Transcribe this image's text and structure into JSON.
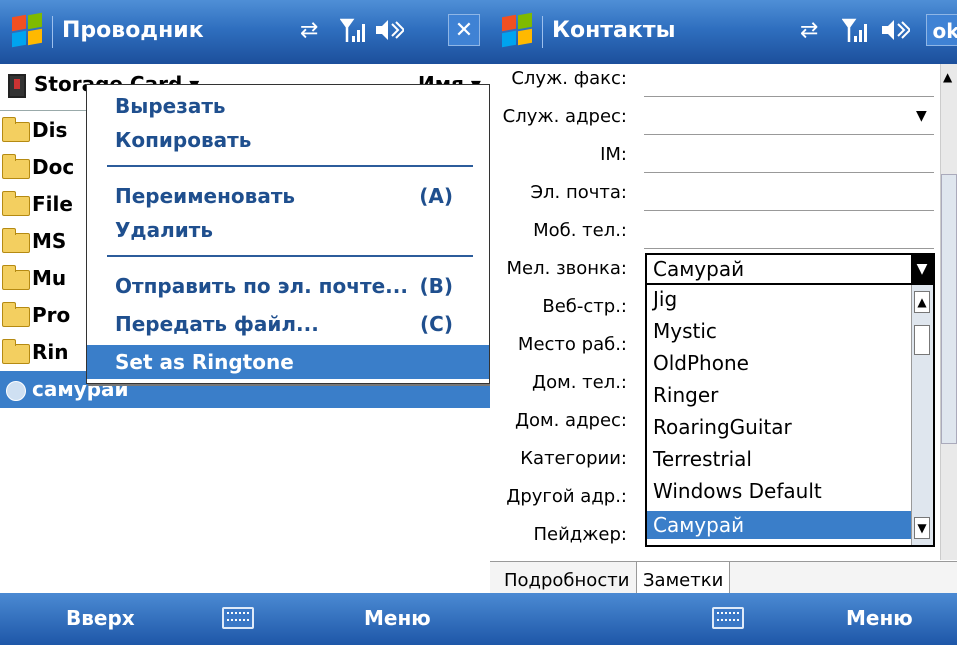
{
  "left": {
    "title": "Проводник",
    "path": "Storage Card ▾",
    "sort": "Имя ▾",
    "rows": [
      "Dis",
      "Doc",
      "File",
      "MS",
      "Mu",
      "Pro",
      "Rin",
      "самурай"
    ],
    "selected_row_extra": "",
    "menu": {
      "cut": "Вырезать",
      "copy": "Копировать",
      "rename": "Переименовать",
      "rename_sc": "(A)",
      "delete": "Удалить",
      "send": "Отправить по эл. почте...",
      "send_sc": "(B)",
      "beam": "Передать файл...",
      "beam_sc": "(C)",
      "ringtone": "Set as Ringtone"
    },
    "soft_left": "Вверх",
    "soft_right": "Меню"
  },
  "right": {
    "title": "Контакты",
    "ok": "ok",
    "labels": [
      "Служ. факс:",
      "Служ. адрес:",
      "IM:",
      "Эл. почта:",
      "Моб. тел.:",
      "Мел. звонка:",
      "Веб-стр.:",
      "Место раб.:",
      "Дом. тел.:",
      "Дом. адрес:",
      "Категории:",
      "Другой адр.:",
      "Пейджер:"
    ],
    "ringtone_value": "Самурай",
    "options": [
      "Jig",
      "Mystic",
      "OldPhone",
      "Ringer",
      "RoaringGuitar",
      "Terrestrial",
      "Windows Default",
      "Самурай"
    ],
    "tabs": [
      "Подробности",
      "Заметки"
    ],
    "soft_right": "Меню"
  },
  "colors": {
    "titlebar": "#2f6fbf",
    "selection": "#3a7ec9",
    "menu_text": "#1f4f8e"
  },
  "icons": [
    "windows-logo-icon",
    "sync-icon",
    "signal-icon",
    "volume-icon",
    "close-icon",
    "keyboard-icon",
    "folder-icon",
    "storage-card-icon"
  ]
}
